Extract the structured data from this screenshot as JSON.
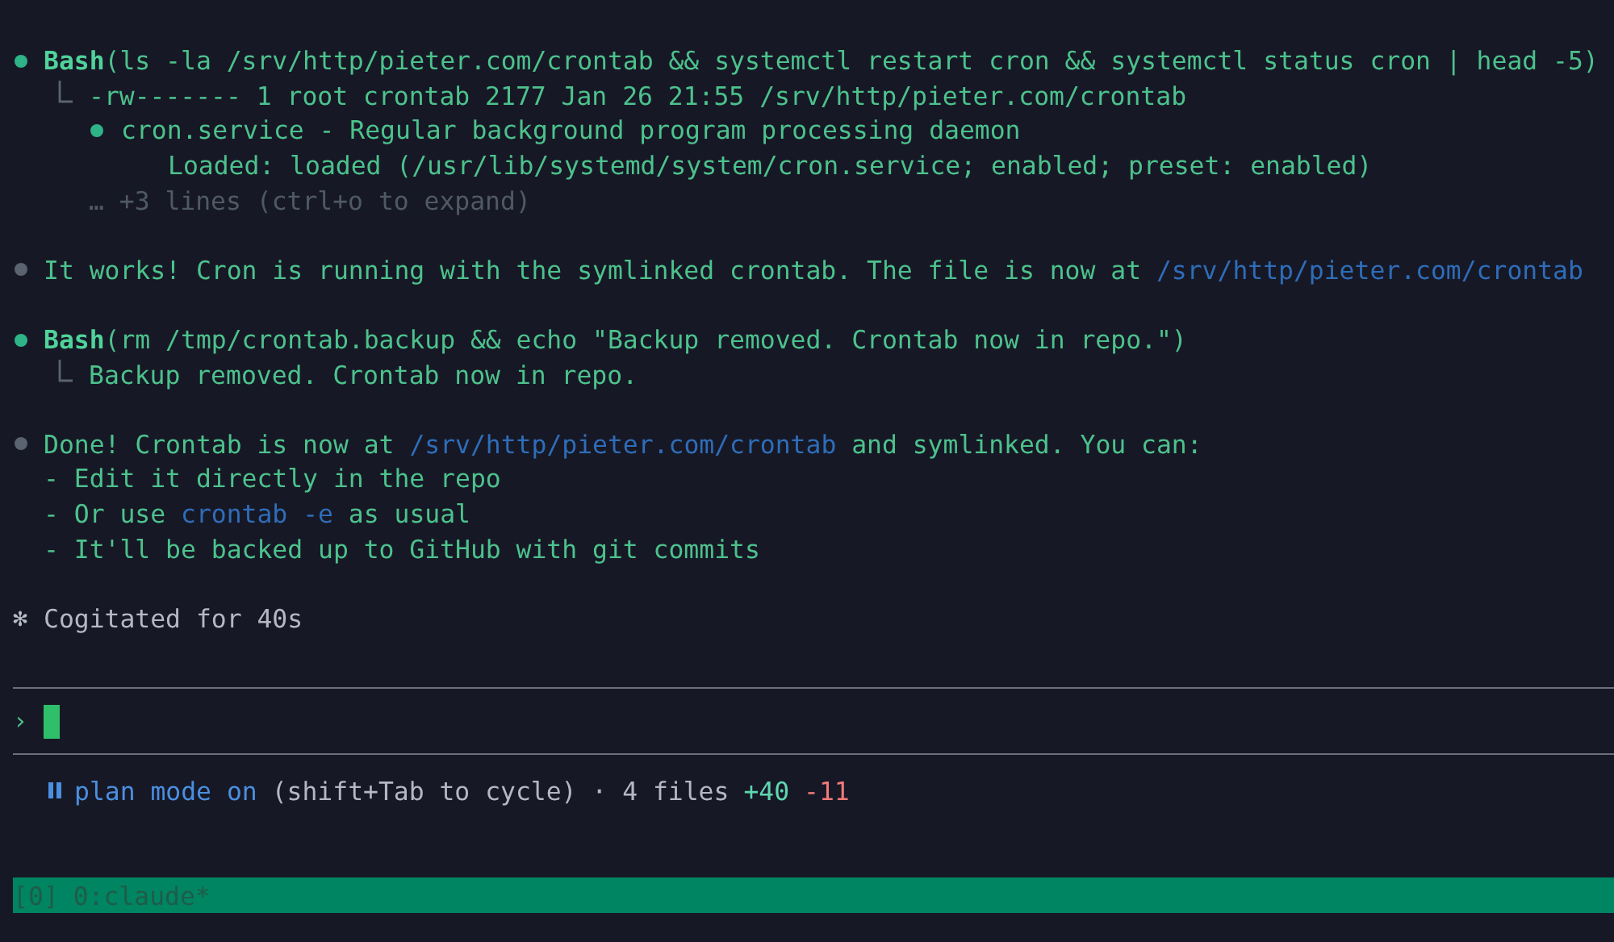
{
  "messages": [
    {
      "kind": "tool",
      "tool": "Bash",
      "command": "(ls -la /srv/http/pieter.com/crontab && systemctl restart cron && systemctl status cron | head -5)",
      "output": [
        {
          "kind": "line",
          "text": "-rw------- 1 root crontab 2177 Jan 26 21:55 /srv/http/pieter.com/crontab"
        },
        {
          "kind": "status",
          "text": "cron.service - Regular background program processing daemon"
        },
        {
          "kind": "detail",
          "text": "Loaded: loaded (/usr/lib/systemd/system/cron.service; enabled; preset: enabled)"
        },
        {
          "kind": "collapsed",
          "text": "… +3 lines (ctrl+o to expand)"
        }
      ]
    },
    {
      "kind": "text",
      "lines": [
        [
          {
            "text": "It works! Cron is running with the symlinked crontab. The file is now at ",
            "path": false
          },
          {
            "text": "/srv/http/pieter.com/crontab",
            "path": true
          }
        ]
      ]
    },
    {
      "kind": "tool",
      "tool": "Bash",
      "command": "(rm /tmp/crontab.backup && echo \"Backup removed. Crontab now in repo.\")",
      "output": [
        {
          "kind": "line",
          "text": "Backup removed. Crontab now in repo."
        }
      ]
    },
    {
      "kind": "text",
      "lines": [
        [
          {
            "text": "Done! Crontab is now at ",
            "path": false
          },
          {
            "text": "/srv/http/pieter.com/crontab",
            "path": true
          },
          {
            "text": " and symlinked. You can:",
            "path": false
          }
        ],
        [
          {
            "text": "- Edit it directly in the repo",
            "path": false
          }
        ],
        [
          {
            "text": "- Or use ",
            "path": false
          },
          {
            "text": "crontab -e",
            "path": true
          },
          {
            "text": " as usual",
            "path": false
          }
        ],
        [
          {
            "text": "- It'll be backed up to GitHub with git commits",
            "path": false
          }
        ]
      ]
    },
    {
      "kind": "thinking",
      "symbol": "✻",
      "text": "Cogitated for 40s"
    }
  ],
  "prompt": {
    "symbol": "›"
  },
  "status": {
    "mode": "plan mode on",
    "hint": "(shift+Tab to cycle) · 4 files",
    "added": "+40",
    "removed": "-11"
  },
  "tmux": {
    "session": "[0]",
    "window": "0:claude*"
  }
}
